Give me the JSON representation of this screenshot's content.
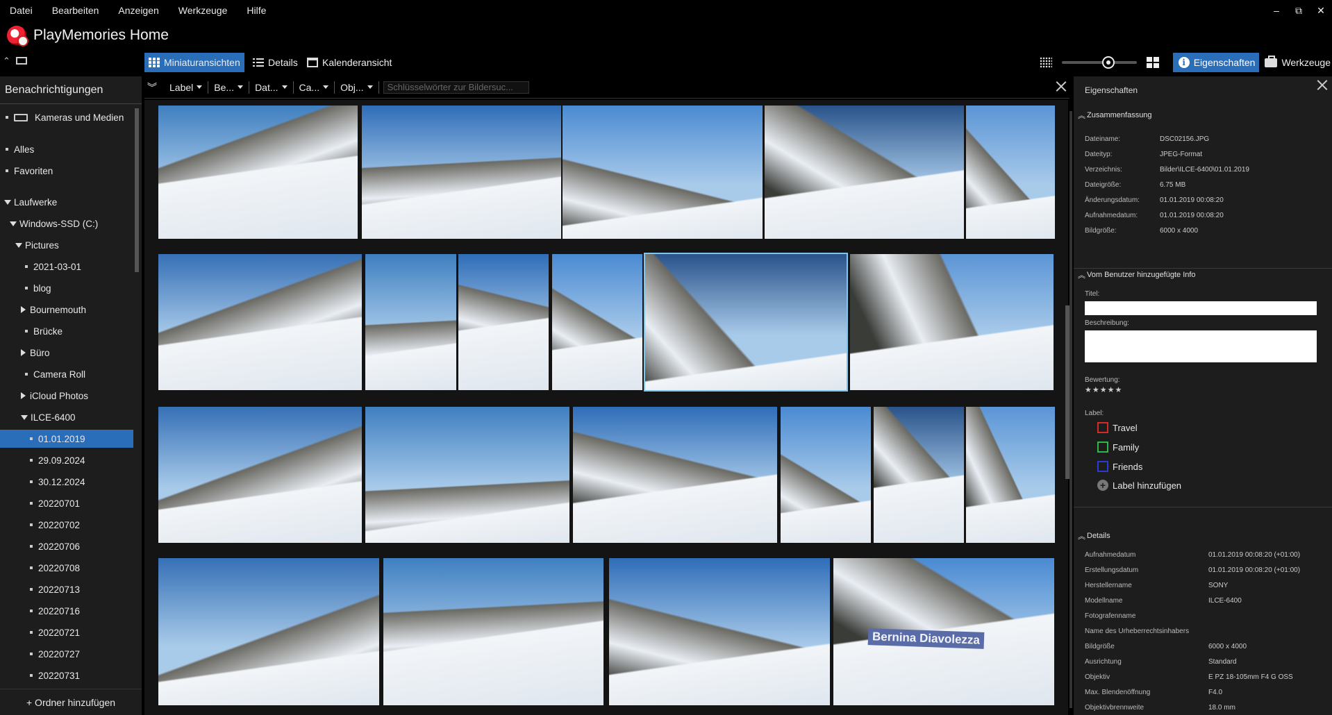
{
  "menu": [
    "Datei",
    "Bearbeiten",
    "Anzeigen",
    "Werkzeuge",
    "Hilfe"
  ],
  "app": {
    "title": "PlayMemories Home"
  },
  "window_controls": {
    "minimize": "–",
    "restore": "⧉",
    "close": "✕"
  },
  "views": {
    "thumbs": "Miniaturansichten",
    "details": "Details",
    "calendar": "Kalenderansicht"
  },
  "toolbar_right": {
    "properties": "Eigenschaften",
    "tools": "Werkzeuge",
    "zoom_level": 0.62
  },
  "left": {
    "header": "Benachrichtigungen",
    "cameras": "Kameras und Medien",
    "all": "Alles",
    "favorites": "Favoriten",
    "drives": "Laufwerke",
    "drive_c": "Windows-SSD (C:)",
    "pictures": "Pictures",
    "folders": [
      {
        "label": "2021-03-01",
        "type": "bullet"
      },
      {
        "label": "blog",
        "type": "bullet"
      },
      {
        "label": "Bournemouth",
        "type": "arrow"
      },
      {
        "label": "Brücke",
        "type": "bullet"
      },
      {
        "label": "Büro",
        "type": "arrow"
      },
      {
        "label": "Camera Roll",
        "type": "bullet"
      },
      {
        "label": "iCloud Photos",
        "type": "arrow"
      },
      {
        "label": "ILCE-6400",
        "type": "open"
      }
    ],
    "subfolders": [
      "01.01.2019",
      "29.09.2024",
      "30.12.2024",
      "20220701",
      "20220702",
      "20220706",
      "20220708",
      "20220713",
      "20220716",
      "20220721",
      "20220727",
      "20220731"
    ],
    "selected": "01.01.2019",
    "add_folder": "+ Ordner hinzufügen"
  },
  "filter": {
    "label": "Label",
    "rating": "Be...",
    "date": "Dat...",
    "camera": "Ca...",
    "object": "Obj...",
    "keyword_placeholder": "Schlüsselwörter zur Bildersuc..."
  },
  "properties": {
    "title": "Eigenschaften",
    "summary_title": "Zusammenfassung",
    "summary": [
      {
        "k": "Dateiname:",
        "v": "DSC02156.JPG"
      },
      {
        "k": "Dateityp:",
        "v": "JPEG-Format"
      },
      {
        "k": "Verzeichnis:",
        "v": "Bilder\\ILCE-6400\\01.01.2019"
      },
      {
        "k": "Dateigröße:",
        "v": "6.75 MB"
      },
      {
        "k": "Änderungsdatum:",
        "v": "01.01.2019 00:08:20"
      },
      {
        "k": "Aufnahmedatum:",
        "v": "01.01.2019 00:08:20"
      },
      {
        "k": "Bildgröße:",
        "v": "6000 x 4000"
      }
    ],
    "user_info_title": "Vom Benutzer hinzugefügte Info",
    "title_label": "Titel:",
    "desc_label": "Beschreibung:",
    "rating_label": "Bewertung:",
    "rating_stars": "★★★★★",
    "label_label": "Label:",
    "labels": [
      {
        "name": "Travel",
        "color": "#d42a2a"
      },
      {
        "name": "Family",
        "color": "#2fb84a"
      },
      {
        "name": "Friends",
        "color": "#2a3bd4"
      }
    ],
    "add_label": "Label hinzufügen",
    "details_title": "Details",
    "details": [
      {
        "k": "Aufnahmedatum",
        "v": "01.01.2019 00:08:20 (+01:00)"
      },
      {
        "k": "Erstellungsdatum",
        "v": "01.01.2019 00:08:20 (+01:00)"
      },
      {
        "k": "Herstellername",
        "v": "SONY"
      },
      {
        "k": "Modellname",
        "v": "ILCE-6400"
      },
      {
        "k": "Fotografenname",
        "v": ""
      },
      {
        "k": "Name des Urheberrechtsinhabers",
        "v": ""
      },
      {
        "k": "Bildgröße",
        "v": "6000 x 4000"
      },
      {
        "k": "Ausrichtung",
        "v": "Standard"
      },
      {
        "k": "Objektiv",
        "v": "E PZ 18-105mm F4 G OSS"
      },
      {
        "k": "Max. Blendenöffnung",
        "v": "F4.0"
      },
      {
        "k": "Objektivbrennweite",
        "v": "18.0 mm"
      }
    ]
  },
  "photo_sign": "Bernina Diavolezza",
  "colors": {
    "accent": "#2a6db8",
    "selection_border": "#7fc6ea"
  }
}
